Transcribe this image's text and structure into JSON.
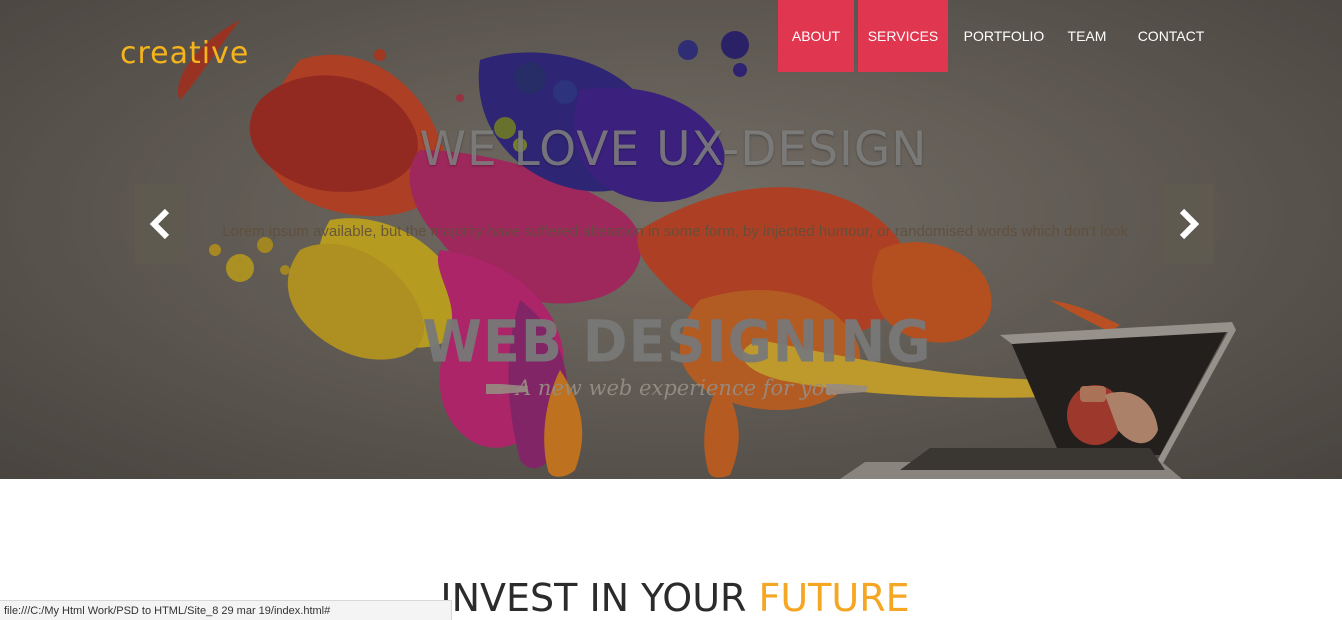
{
  "brand": {
    "logo_text": "creative",
    "color": "#f5b31c"
  },
  "nav": {
    "items": [
      {
        "label": "ABOUT",
        "active": true
      },
      {
        "label": "SERVICES",
        "active": true
      },
      {
        "label": "PORTFOLIO",
        "active": false
      },
      {
        "label": "TEAM",
        "active": false
      },
      {
        "label": "CONTACT",
        "active": false
      }
    ],
    "active_color": "#e0364f"
  },
  "hero": {
    "headline": "WE LOVE UX-DESIGN",
    "subline": "Lorem ipsum available, but the majority have suffered alteration in some form, by injected humour, or randomised words which don't look",
    "title": "WEB DESIGNING",
    "tagline": "A new web experience for you",
    "prev_icon": "chevron-left-icon",
    "next_icon": "chevron-right-icon"
  },
  "section": {
    "title_main": "INVEST IN YOUR ",
    "title_accent": "FUTURE",
    "accent_color": "#f5a623"
  },
  "status_bar": {
    "url": "file:///C:/My Html Work/PSD to HTML/Site_8 29 mar 19/index.html#"
  }
}
